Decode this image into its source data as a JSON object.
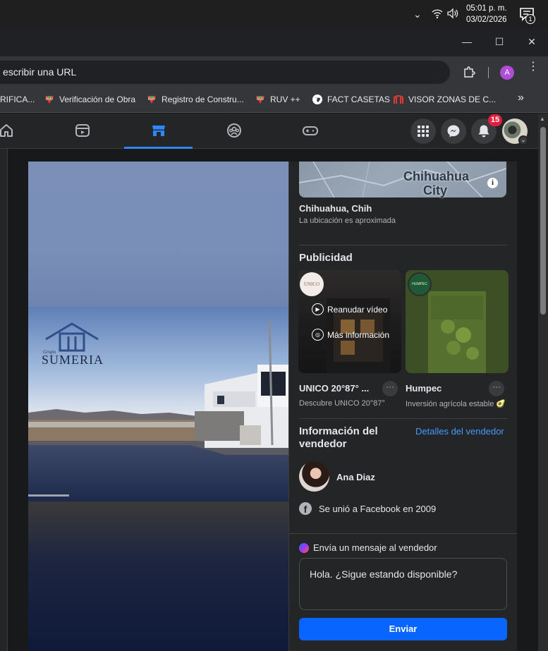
{
  "taskbar": {
    "time": "05:01 p. m.",
    "date": "03/02/2026",
    "notification_count": "1"
  },
  "browser": {
    "omnibox_text": "escribir una URL",
    "profile_initial": "A",
    "bookmarks": [
      {
        "label": "RIFICA...",
        "icon": "folder-icon"
      },
      {
        "label": "Verificación de Obra",
        "icon": "ruv-icon"
      },
      {
        "label": "Registro de Constru...",
        "icon": "ruv-icon"
      },
      {
        "label": "RUV ++",
        "icon": "ruv-icon"
      },
      {
        "label": "FACT CASETAS",
        "icon": "globe-icon"
      },
      {
        "label": "VISOR ZONAS DE C...",
        "icon": "gate-icon"
      }
    ],
    "bookmarks_more": "»"
  },
  "fbnav": {
    "notification_badge": "15",
    "active_tab": "marketplace"
  },
  "photo": {
    "logo_small": "Grupo",
    "logo_text": "SUMERIA"
  },
  "location": {
    "map_city": "Chihuahua City",
    "title": "Chihuahua, Chih",
    "subtitle": "La ubicación es aproximada"
  },
  "ads": {
    "heading": "Publicidad",
    "items": [
      {
        "title": "UNICO 20°87° ...",
        "subtitle": "Descubre UNICO 20°87°",
        "logo_text": "UNICO",
        "actions": [
          "Reanudar vídeo",
          "Más información"
        ]
      },
      {
        "title": "Humpec",
        "subtitle": "Inversión agrícola estable 🥑",
        "logo_text": "HUMPEC"
      }
    ]
  },
  "seller": {
    "heading": "Información del vendedor",
    "details_link": "Detalles del vendedor",
    "name": "Ana Diaz",
    "joined": "Se unió a Facebook en 2009"
  },
  "message": {
    "heading": "Envía un mensaje al vendedor",
    "value": "Hola. ¿Sigue estando disponible?",
    "send_label": "Enviar"
  },
  "colors": {
    "accent": "#0866ff",
    "link": "#4599ff",
    "badge": "#e41e3f",
    "panel": "#242526"
  }
}
